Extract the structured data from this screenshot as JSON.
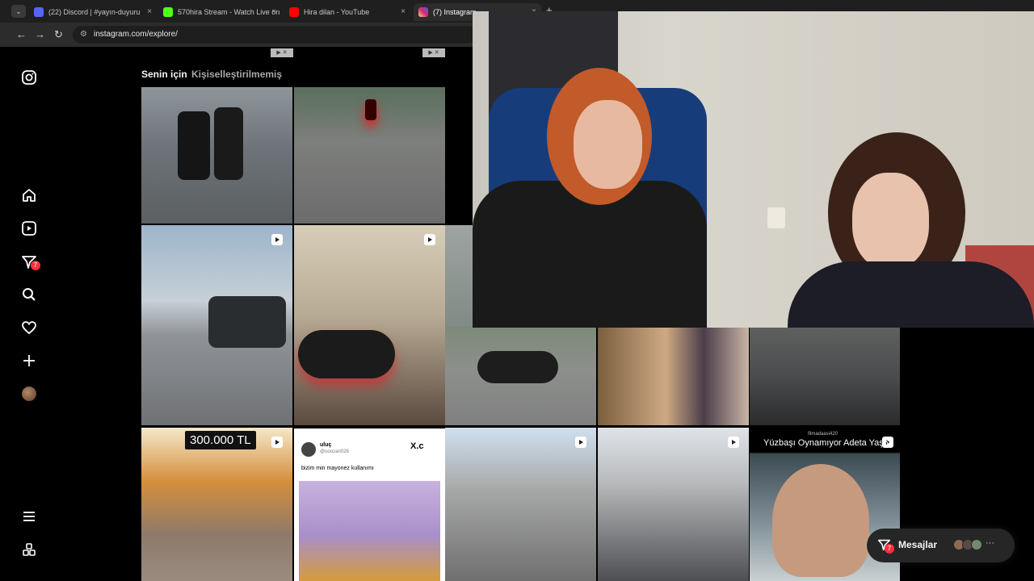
{
  "browser": {
    "tabs": [
      {
        "label": "(22) Discord | #yayın-duyuru",
        "color": "#5865f2"
      },
      {
        "label": "570hira Stream - Watch Live on",
        "color": "#53fc18"
      },
      {
        "label": "Hira dilan - YouTube",
        "color": "#ff0000"
      },
      {
        "label": "(7) Instagram",
        "color": "#e1306c"
      }
    ],
    "tab_close": "×",
    "new_tab": "+",
    "url": "instagram.com/explore/"
  },
  "sidebar": {
    "notification_count": "7"
  },
  "explore": {
    "tabs": [
      "Senin için",
      "Kişiselleştirilmemiş"
    ]
  },
  "posts": {
    "price_label": "300.000 TL",
    "tweet": {
      "name": "uluç",
      "handle": "@uoozan026",
      "text": "bizim min mayonez kullanımı",
      "logo": "X.c"
    },
    "reel_caption": "Yüzbaşı Oynamıyor Adeta Yaşıy",
    "reel_author": "filmadaasi420"
  },
  "messages": {
    "label": "Mesajlar",
    "count": "7",
    "more": "···"
  },
  "colors": {
    "accent": "#ff3040",
    "background": "#000000"
  }
}
